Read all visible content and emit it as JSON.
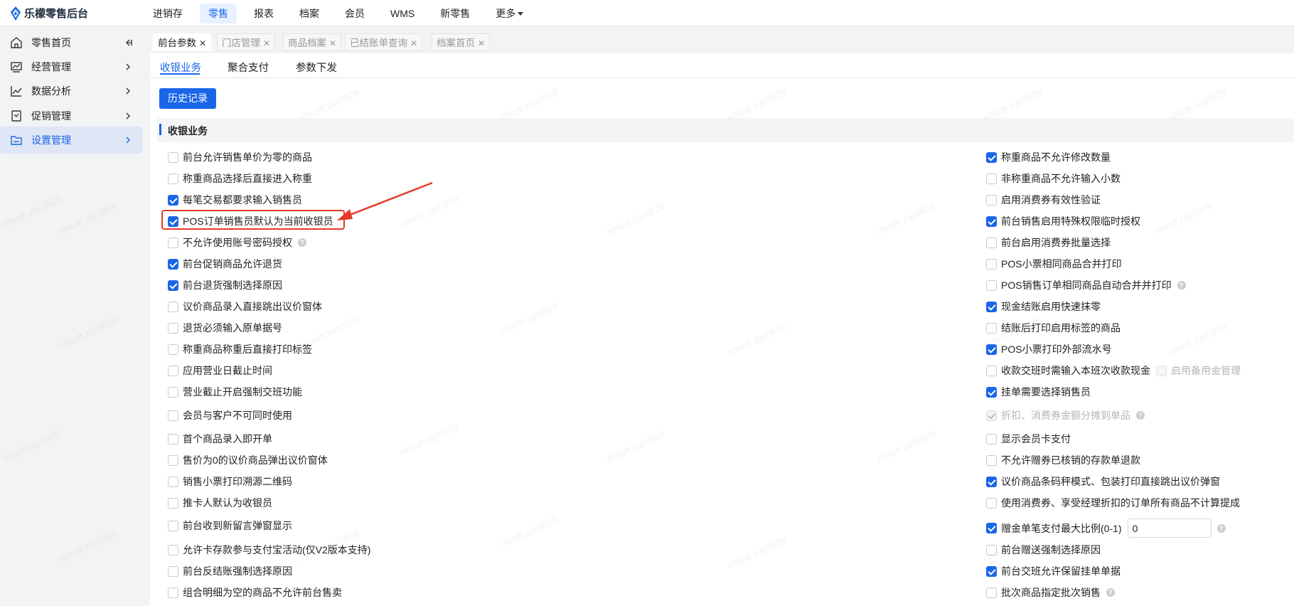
{
  "app": {
    "title": "乐檬零售后台"
  },
  "topnav": [
    {
      "label": "进销存",
      "active": false
    },
    {
      "label": "零售",
      "active": true
    },
    {
      "label": "报表",
      "active": false
    },
    {
      "label": "档案",
      "active": false
    },
    {
      "label": "会员",
      "active": false
    },
    {
      "label": "WMS",
      "active": false
    },
    {
      "label": "新零售",
      "active": false
    },
    {
      "label": "更多",
      "active": false
    }
  ],
  "sidebar": {
    "items": [
      {
        "label": "零售首页",
        "icon": "home-icon"
      },
      {
        "label": "经营管理",
        "icon": "chart-board-icon"
      },
      {
        "label": "数据分析",
        "icon": "trend-icon"
      },
      {
        "label": "促销管理",
        "icon": "promo-icon"
      },
      {
        "label": "设置管理",
        "icon": "folder-icon",
        "active": true
      }
    ]
  },
  "page_tabs": [
    {
      "label": "前台参数",
      "active": true
    },
    {
      "label": "门店管理"
    },
    {
      "label": "商品档案"
    },
    {
      "label": "已结账单查询"
    },
    {
      "label": "档案首页"
    }
  ],
  "sub_tabs": [
    {
      "label": "收银业务",
      "active": true
    },
    {
      "label": "聚合支付"
    },
    {
      "label": "参数下发"
    }
  ],
  "history_button": "历史记录",
  "section_title": "收银业务",
  "left_options": [
    {
      "label": "前台允许销售单价为零的商品",
      "checked": false
    },
    {
      "label": "称重商品选择后直接进入称重",
      "checked": false
    },
    {
      "label": "每笔交易都要求输入销售员",
      "checked": true
    },
    {
      "label": "POS订单销售员默认为当前收银员",
      "checked": true
    },
    {
      "label": "不允许使用账号密码授权",
      "checked": false,
      "help": true
    },
    {
      "label": "前台促销商品允许退货",
      "checked": true
    },
    {
      "label": "前台退货强制选择原因",
      "checked": true
    },
    {
      "label": "议价商品录入直接跳出议价窗体",
      "checked": false
    },
    {
      "label": "退货必须输入原单据号",
      "checked": false
    },
    {
      "label": "称重商品称重后直接打印标签",
      "checked": false
    },
    {
      "label": "应用营业日截止时间",
      "checked": false
    },
    {
      "label": "营业截止开启强制交班功能",
      "checked": false
    },
    {
      "label": "会员与客户不可同时使用",
      "checked": false
    },
    {
      "label": "首个商品录入即开单",
      "checked": false
    },
    {
      "label": "售价为0的议价商品弹出议价窗体",
      "checked": false
    },
    {
      "label": "销售小票打印溯源二维码",
      "checked": false
    },
    {
      "label": "推卡人默认为收银员",
      "checked": false
    },
    {
      "label": "前台收到新留言弹窗显示",
      "checked": false
    },
    {
      "label": "允许卡存款参与支付宝活动(仅V2版本支持)",
      "checked": false
    },
    {
      "label": "前台反结账强制选择原因",
      "checked": false
    },
    {
      "label": "组合明细为空的商品不允许前台售卖",
      "checked": false
    }
  ],
  "right_options": [
    {
      "label": "称重商品不允许修改数量",
      "checked": true
    },
    {
      "label": "非称重商品不允许输入小数",
      "checked": false
    },
    {
      "label": "启用消费券有效性验证",
      "checked": false
    },
    {
      "label": "前台销售启用特殊权限临时授权",
      "checked": true
    },
    {
      "label": "前台启用消费券批量选择",
      "checked": false
    },
    {
      "label": "POS小票相同商品合并打印",
      "checked": false
    },
    {
      "label": "POS销售订单相同商品自动合并并打印",
      "checked": false,
      "help": true
    },
    {
      "label": "现金结账启用快速抹零",
      "checked": true
    },
    {
      "label": "结账后打印启用标签的商品",
      "checked": false
    },
    {
      "label": "POS小票打印外部流水号",
      "checked": true
    },
    {
      "label": "收款交班时需输入本班次收款现金",
      "checked": false,
      "extra": "启用备用金管理"
    },
    {
      "label": "挂单需要选择销售员",
      "checked": true
    },
    {
      "label": "折扣、消费券金额分摊到单品",
      "checked": true,
      "disabled": true,
      "help": true
    },
    {
      "label": "显示会员卡支付",
      "checked": false
    },
    {
      "label": "不允许赠券已核销的存款单退款",
      "checked": false
    },
    {
      "label": "议价商品条码秤模式、包装打印直接跳出议价弹窗",
      "checked": true
    },
    {
      "label": "使用消费券、享受经理折扣的订单所有商品不计算提成",
      "checked": false
    },
    {
      "label": "赠金单笔支付最大比例(0-1)",
      "checked": true,
      "input": "0",
      "help": true
    },
    {
      "label": "前台赠送强制选择原因",
      "checked": false
    },
    {
      "label": "前台交班允许保留挂单单据",
      "checked": true
    },
    {
      "label": "批次商品指定批次销售",
      "checked": false,
      "help": true
    }
  ],
  "watermark": "nhsoft.zqc0829",
  "colors": {
    "accent": "#1a66e8",
    "highlight": "#e33a2a"
  }
}
